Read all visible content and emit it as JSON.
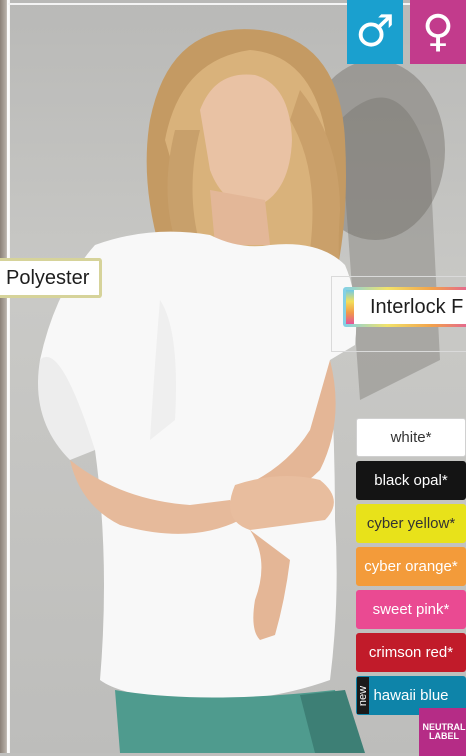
{
  "gender": {
    "male_symbol": "♂",
    "female_symbol": "♀"
  },
  "fabric": {
    "polyester": "Polyester",
    "interlock": "Interlock F"
  },
  "swatches": [
    {
      "label": "white*",
      "bg": "#ffffff",
      "color": "#333333",
      "border": "#d0d0d0"
    },
    {
      "label": "black opal*",
      "bg": "#141414",
      "color": "#ffffff",
      "border": "#141414"
    },
    {
      "label": "cyber yellow*",
      "bg": "#e8e21a",
      "color": "#333333",
      "border": "#e8e21a"
    },
    {
      "label": "cyber orange*",
      "bg": "#f39b3a",
      "color": "#ffffff",
      "border": "#f39b3a"
    },
    {
      "label": "sweet pink*",
      "bg": "#ea4a92",
      "color": "#ffffff",
      "border": "#ea4a92"
    },
    {
      "label": "crimson red*",
      "bg": "#c11b2a",
      "color": "#ffffff",
      "border": "#c11b2a"
    },
    {
      "label": "hawaii blue",
      "bg": "#0e84a9",
      "color": "#ffffff",
      "border": "#0e84a9",
      "badge": "new"
    }
  ],
  "neutral_label": {
    "line1": "NEUTRAL",
    "line2": "LABEL"
  }
}
